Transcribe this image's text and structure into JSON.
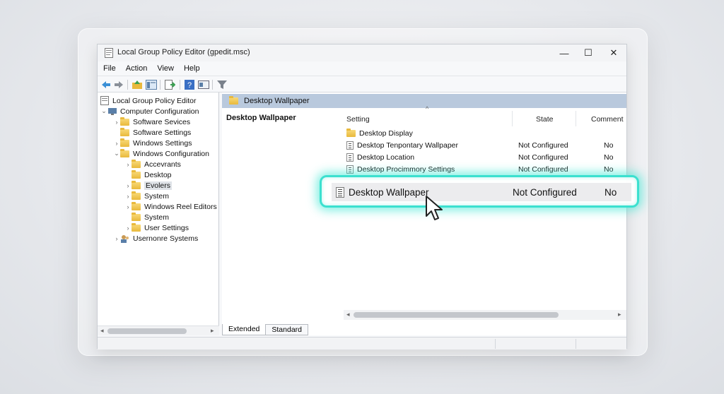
{
  "window": {
    "title": "Local Group Policy Editor (gpedit.msc)",
    "minimize": "—",
    "maximize": "☐",
    "close": "✕"
  },
  "menu": [
    "File",
    "Action",
    "View",
    "Help"
  ],
  "tree": [
    {
      "label": "Local Group Policy Editor",
      "chevron": "",
      "icon": "policy-icon"
    },
    {
      "label": "Computer Configuration",
      "chevron": "⌄",
      "icon": "computer-icon"
    },
    {
      "label": "Software Sevices",
      "chevron": "›",
      "icon": "folder-icon"
    },
    {
      "label": "Software Settings",
      "chevron": "",
      "icon": "folder-icon"
    },
    {
      "label": "Windows Settings",
      "chevron": "›",
      "icon": "folder-icon"
    },
    {
      "label": "Windows Configuration",
      "chevron": "⌄",
      "icon": "folder-icon"
    },
    {
      "label": "Accevrants",
      "chevron": "›",
      "icon": "folder-icon"
    },
    {
      "label": "Desktop",
      "chevron": "",
      "icon": "folder-icon"
    },
    {
      "label": "Evolers",
      "chevron": "›",
      "icon": "folder-icon",
      "selected": true
    },
    {
      "label": "System",
      "chevron": "›",
      "icon": "folder-icon"
    },
    {
      "label": "Windows Reel Editors",
      "chevron": "›",
      "icon": "folder-icon"
    },
    {
      "label": "System",
      "chevron": "",
      "icon": "folder-icon"
    },
    {
      "label": "User Settings",
      "chevron": "›",
      "icon": "folder-icon"
    },
    {
      "label": "Usernonre Systems",
      "chevron": "›",
      "icon": "users-icon"
    }
  ],
  "right": {
    "header": "Desktop Wallpaper",
    "description_title": "Desktop Wallpaper",
    "columns": {
      "setting": "Setting",
      "state": "State",
      "comment": "Comment"
    },
    "rows": [
      {
        "name": "Desktop Display",
        "state": "",
        "comment": "",
        "icon": "folder-icon"
      },
      {
        "name": "Desktop Tenpontary Wallpaper",
        "state": "Not Configured",
        "comment": "No",
        "icon": "setting-icon"
      },
      {
        "name": "Desktop Location",
        "state": "Not Configured",
        "comment": "No",
        "icon": "setting-icon"
      },
      {
        "name": "Desktop Procimmory Settings",
        "state": "Not Configured",
        "comment": "No",
        "icon": "setting-icon"
      }
    ],
    "highlighted": {
      "name": "Desktop Wallpaper",
      "state": "Not Configured",
      "comment": "No"
    }
  },
  "tabs": [
    "Extended",
    "Standard"
  ],
  "colors": {
    "highlight_glow": "#3be0cf",
    "header_band": "#b9c9dd"
  }
}
